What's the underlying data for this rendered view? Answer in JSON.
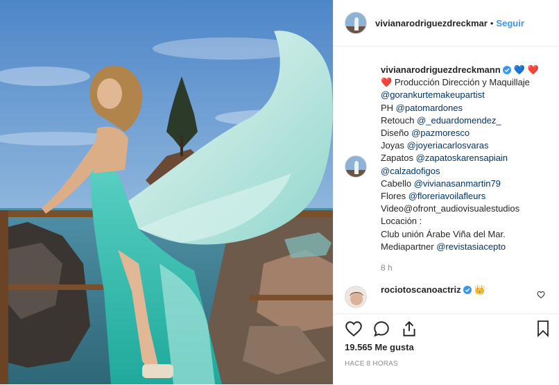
{
  "post": {
    "username": "vivianarodriguezdreckmar",
    "follow_label": "Seguir",
    "separator": "•",
    "caption": {
      "author": "vivianarodriguezdreckmann",
      "heart_blue": "💙",
      "heart_red": "❤️",
      "line1": "Producción Dirección y Maquillaje",
      "line2_mention": "@gorankurtemakeupartist",
      "line3_prefix": "PH ",
      "line3_mention": "@patomardones",
      "line4_prefix": "Retouch ",
      "line4_mention": "@_eduardomendez_",
      "line5_prefix": "Diseño ",
      "line5_mention": "@pazmoresco",
      "line6_prefix": "Joyas ",
      "line6_mention": "@joyeriacarlosvaras",
      "line7_prefix": "Zapatos ",
      "line7_mention": "@zapatoskarensapiain",
      "line8_mention": "@calzadofigos",
      "line9_prefix": "Cabello ",
      "line9_mention": "@vivianasanmartin79",
      "line10_prefix": "Flores ",
      "line10_mention": "@floreriavoilafleurs",
      "line11": "Video@ofront_audiovisualestudios",
      "line12": "Locación :",
      "line13": "Club unión Árabe Viña del Mar.",
      "line14_prefix": "Mediapartner ",
      "line14_mention": "@revistasiacepto",
      "time": "8 h"
    },
    "comment": {
      "username": "rociotoscanoactriz",
      "emoji": "👑"
    },
    "likes_text": "19.565 Me gusta",
    "time_ago": "HACE 8 HORAS"
  },
  "colors": {
    "link": "#3897f0",
    "mention": "#003569",
    "verified": "#3897f0",
    "muted": "#8e8e8e"
  },
  "icons": [
    "heart-icon",
    "comment-icon",
    "share-icon",
    "bookmark-icon",
    "verified-icon",
    "small-heart-icon"
  ]
}
